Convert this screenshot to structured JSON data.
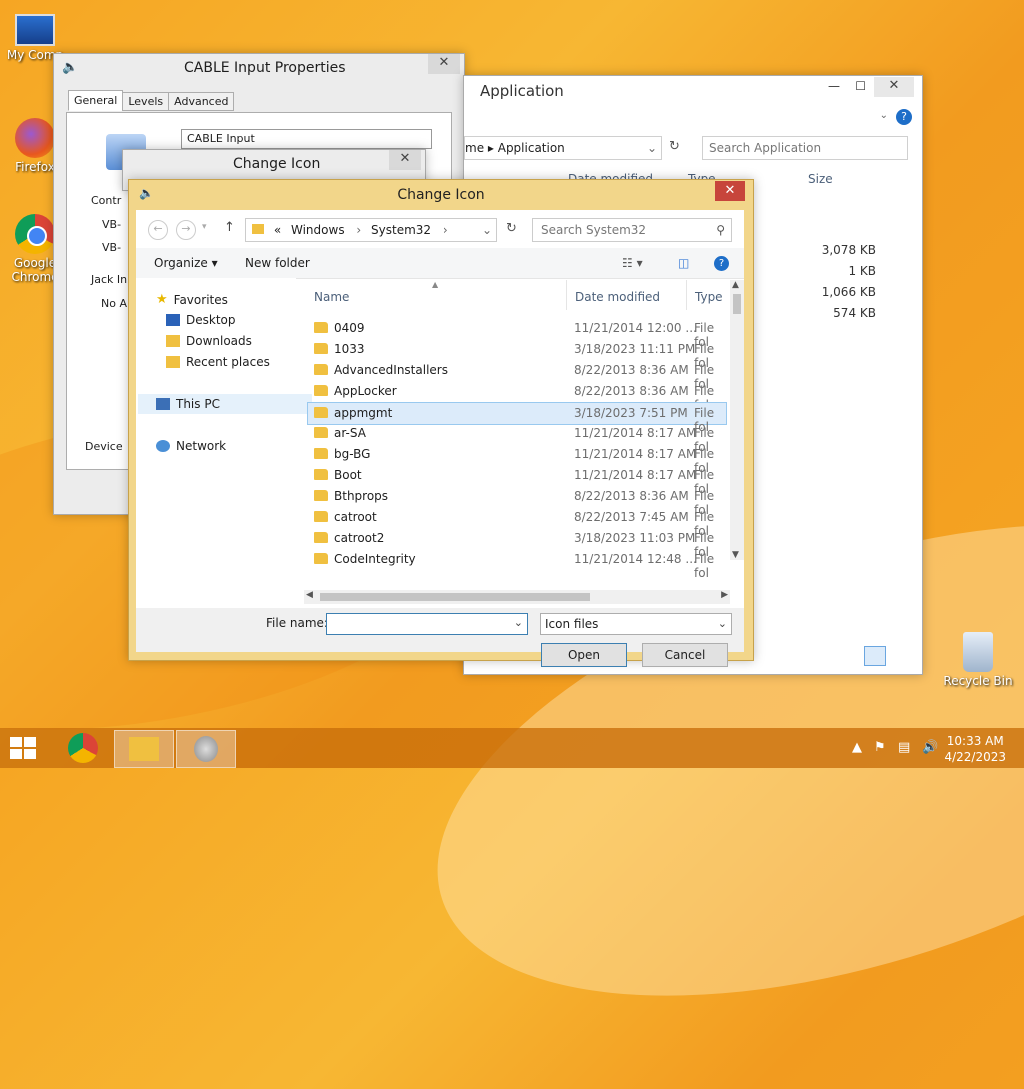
{
  "desktop": {
    "icons": [
      "My Comp",
      "Firefox",
      "Google Chrome",
      "Recycle Bin"
    ]
  },
  "cable_window": {
    "title": "CABLE Input Properties",
    "tabs": [
      "General",
      "Levels",
      "Advanced"
    ],
    "device_name": "CABLE Input",
    "labels": [
      "Contr",
      "VB-",
      "VB-",
      "Jack In",
      "No A",
      "Device"
    ]
  },
  "app_window": {
    "title": "Application",
    "breadcrumb": "Application",
    "search_placeholder": "Search Application",
    "columns": [
      "Date modified",
      "Type",
      "Size"
    ],
    "sizes": [
      "3,078 KB",
      "1 KB",
      "1,066 KB",
      "574 KB"
    ]
  },
  "change_icon_back": {
    "title": "Change Icon"
  },
  "dialog": {
    "title": "Change Icon",
    "breadcrumb": [
      "«",
      "Windows",
      "System32"
    ],
    "search_placeholder": "Search System32",
    "toolbar": {
      "organize": "Organize",
      "new_folder": "New folder"
    },
    "nav": {
      "favorites": "Favorites",
      "desktop": "Desktop",
      "downloads": "Downloads",
      "recent": "Recent places",
      "this_pc": "This PC",
      "network": "Network"
    },
    "columns": {
      "name": "Name",
      "date": "Date modified",
      "type": "Type"
    },
    "files": [
      {
        "name": "0409",
        "date": "11/21/2014 12:00 ...",
        "type": "File fol"
      },
      {
        "name": "1033",
        "date": "3/18/2023 11:11 PM",
        "type": "File fol"
      },
      {
        "name": "AdvancedInstallers",
        "date": "8/22/2013 8:36 AM",
        "type": "File fol"
      },
      {
        "name": "AppLocker",
        "date": "8/22/2013 8:36 AM",
        "type": "File fol"
      },
      {
        "name": "appmgmt",
        "date": "3/18/2023 7:51 PM",
        "type": "File fol"
      },
      {
        "name": "ar-SA",
        "date": "11/21/2014 8:17 AM",
        "type": "File fol"
      },
      {
        "name": "bg-BG",
        "date": "11/21/2014 8:17 AM",
        "type": "File fol"
      },
      {
        "name": "Boot",
        "date": "11/21/2014 8:17 AM",
        "type": "File fol"
      },
      {
        "name": "Bthprops",
        "date": "8/22/2013 8:36 AM",
        "type": "File fol"
      },
      {
        "name": "catroot",
        "date": "8/22/2013 7:45 AM",
        "type": "File fol"
      },
      {
        "name": "catroot2",
        "date": "3/18/2023 11:03 PM",
        "type": "File fol"
      },
      {
        "name": "CodeIntegrity",
        "date": "11/21/2014 12:48 ...",
        "type": "File fol"
      }
    ],
    "selected_index": 4,
    "file_name_label": "File name:",
    "file_name_value": "",
    "file_type": "Icon files",
    "open_label": "Open",
    "cancel_label": "Cancel"
  },
  "taskbar": {
    "time": "10:33 AM",
    "date": "4/22/2023"
  }
}
